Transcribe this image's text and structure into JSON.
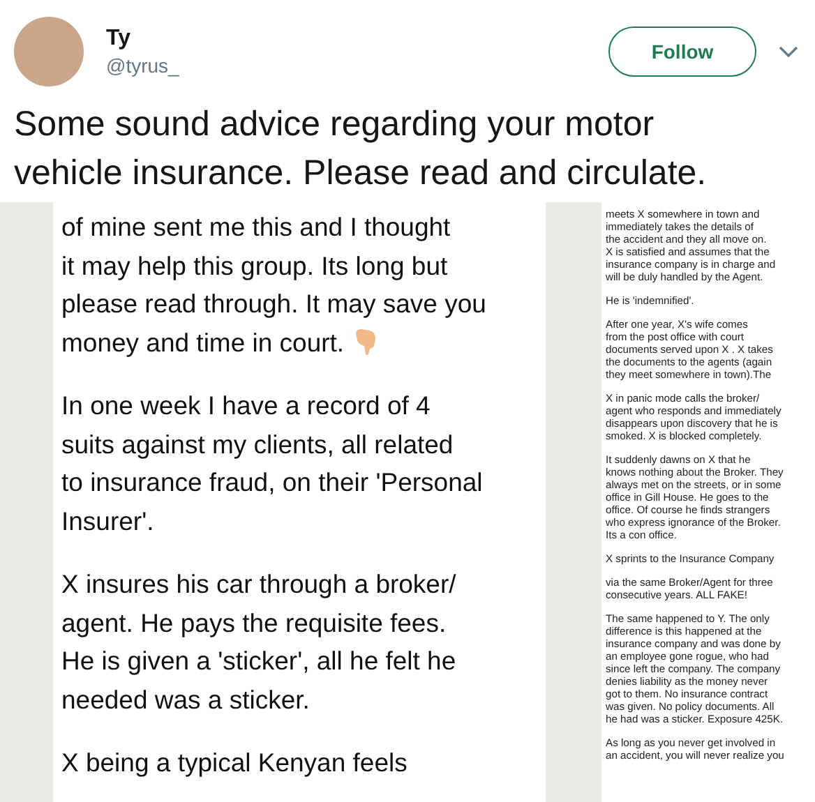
{
  "author": {
    "name": "Ty",
    "handle": "@tyrus_"
  },
  "follow_button": {
    "label": "Follow"
  },
  "tweet_text": "Some sound advice regarding your motor vehicle insurance. Please read and circulate.",
  "left_image": {
    "paragraphs": [
      {
        "lines": [
          "of mine sent me this and I thought",
          "it may help this group. Its long but",
          "please read through. It may save you",
          "money and time in court."
        ],
        "pointing_hand": true
      },
      {
        "lines": [
          "In one week I have a record of 4",
          "suits against my clients, all related",
          "to insurance fraud, on their 'Personal",
          "Insurer'."
        ],
        "pointing_hand": false
      },
      {
        "lines": [
          "X insures his car through a broker/",
          "agent. He pays the requisite fees.",
          "He is given a 'sticker', all he felt he",
          "needed was a sticker."
        ],
        "pointing_hand": false
      },
      {
        "lines": [
          "X being a typical Kenyan feels"
        ],
        "pointing_hand": false
      }
    ]
  },
  "right_image": {
    "paragraphs": [
      {
        "lines": [
          "meets X somewhere in town and",
          "immediately takes the details of",
          "the accident and they all move on.",
          "X is satisfied and assumes that the",
          "insurance company is in charge and",
          "will be duly handled by the Agent."
        ]
      },
      {
        "lines": [
          "He is 'indemnified'."
        ]
      },
      {
        "lines": [
          "After one year, X's wife comes",
          "from the post office with court",
          "documents served upon X . X takes",
          "the documents to the agents (again",
          "they meet somewhere in town).The"
        ]
      },
      {
        "lines": [
          "X in panic mode calls the broker/",
          "agent who responds and immediately",
          "disappears upon discovery that he is",
          "smoked. X is blocked completely."
        ]
      },
      {
        "lines": [
          "It suddenly dawns on X that he",
          "knows nothing about the Broker. They",
          "always met on the streets, or in some",
          "office in Gill House. He goes to the",
          "office. Of course he finds strangers",
          "who express ignorance of the Broker.",
          "Its a con office."
        ]
      },
      {
        "lines": [
          "X sprints to the Insurance Company"
        ]
      },
      {
        "lines": [
          "via the same Broker/Agent for three",
          "consecutive years. ALL FAKE!"
        ]
      },
      {
        "lines": [
          "The same happened to Y. The only",
          "difference is this happened at the",
          "insurance company and was done by",
          "an employee gone rogue, who had",
          "since left the company. The company",
          "denies liability as the money never",
          "got to them. No insurance contract",
          "was given. No policy documents. All",
          "he had was a sticker. Exposure 425K."
        ]
      },
      {
        "lines": [
          "As long as you never get involved in",
          "an accident, you will never realize you"
        ]
      }
    ]
  }
}
